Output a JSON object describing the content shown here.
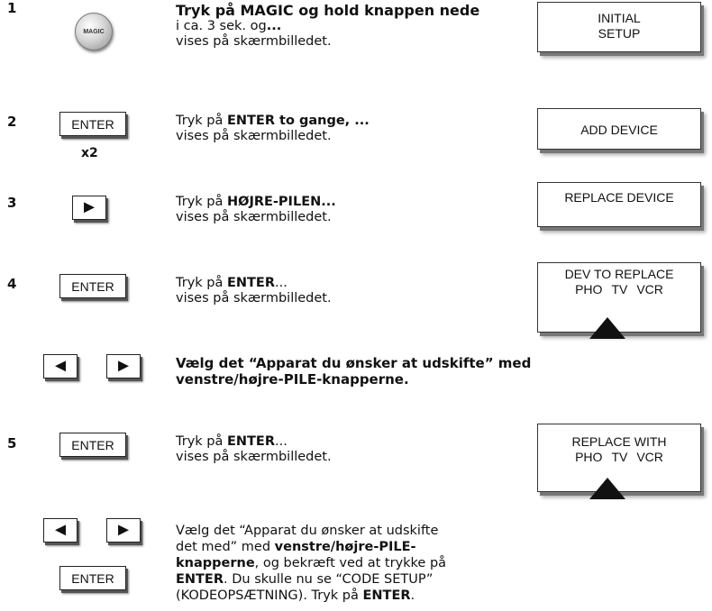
{
  "steps": [
    {
      "number": "1",
      "line1_bold": "Tryk på MAGIC og hold knappen nede",
      "line2_pre": "i ca. 3 sek. og",
      "line2_bold": "...",
      "line3": "vises på skærmbilledet.",
      "display": [
        "INITIAL",
        "SETUP"
      ]
    },
    {
      "number": "2",
      "pre": "Tryk på ",
      "bold": "ENTER to gange, ...",
      "line2": "vises på skærmbilledet.",
      "multiplier": "x2",
      "display": [
        "ADD DEVICE"
      ]
    },
    {
      "number": "3",
      "pre": "Tryk på ",
      "bold": "HØJRE-PILEN...",
      "line2": "vises på skærmbilledet.",
      "display": [
        "REPLACE DEVICE"
      ]
    },
    {
      "number": "4",
      "pre": "Tryk på ",
      "bold": "ENTER",
      "post": "...",
      "line2": "vises på skærmbilledet.",
      "display_title": "DEV TO REPLACE",
      "display_options": [
        "PHO",
        "TV",
        "VCR"
      ]
    },
    {
      "number": "5",
      "pre": "Tryk på ",
      "bold": "ENTER",
      "post": "...",
      "line2": "vises på skærmbilledet.",
      "display_title": "REPLACE WITH",
      "display_options": [
        "PHO",
        "TV",
        "VCR"
      ]
    }
  ],
  "select_note": {
    "line1": "Vælg det “Apparat du ønsker at udskifte” med",
    "line2": "venstre/højre-PILE-knapperne."
  },
  "final_note": {
    "l1": "Vælg det “Apparat du ønsker at udskifte",
    "l2_pre": "det med” med ",
    "l2_bold": "venstre/højre-PILE-",
    "l3_bold": "knapperne",
    "l3_post": ", og bekræft ved at trykke på",
    "l4_bold": "ENTER",
    "l4_post": ". Du skulle nu se “CODE SETUP”",
    "l5_pre": "(KODEOPSÆTNING). Tryk på ",
    "l5_bold": "ENTER",
    "l5_post": "."
  },
  "keys": {
    "magic_label": "MAGIC",
    "enter_label": "ENTER",
    "left_arrow": "◄",
    "right_arrow": "►"
  },
  "icons": {
    "left": "left-arrow-icon",
    "right": "right-arrow-icon",
    "pointer": "triangle-up-icon"
  }
}
